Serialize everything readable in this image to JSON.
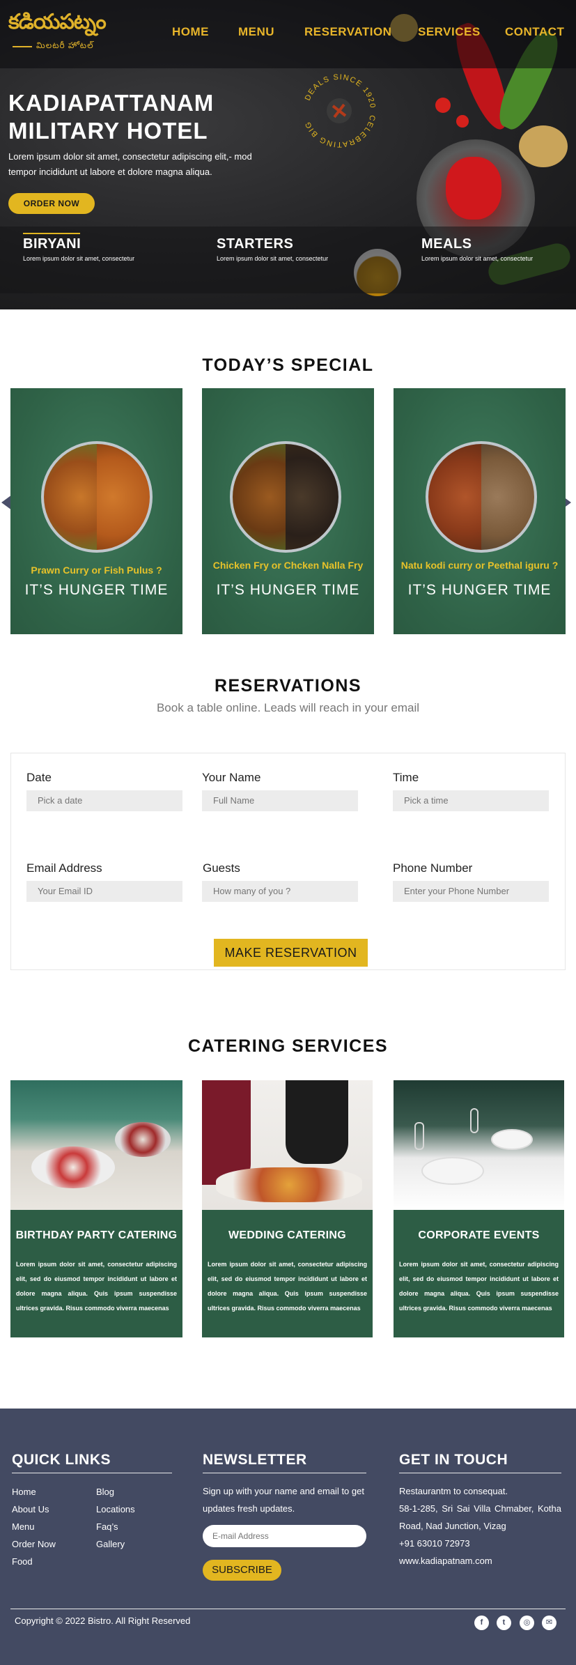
{
  "brand": {
    "logo_main": "కడియపట్నం",
    "logo_sub": "మిలటరీ హోటల్"
  },
  "nav": {
    "home": "HOME",
    "menu": "MENU",
    "reservation": "RESERVATION",
    "services": "SERVICES",
    "contact": "CONTACT"
  },
  "hero": {
    "title": "KADIAPATTANAM MILITARY HOTEL",
    "text": "Lorem ipsum dolor sit amet, consectetur adipiscing elit,- mod tempor incididunt ut labore et dolore magna aliqua.",
    "order_button": "ORDER NOW",
    "badge_top": "DEALS SINCE 1920",
    "badge_side": "CELEBRATING BIG",
    "categories": [
      {
        "title": "BIRYANI",
        "desc": "Lorem ipsum dolor sit amet, consectetur"
      },
      {
        "title": "STARTERS",
        "desc": "Lorem ipsum dolor sit amet, consectetur"
      },
      {
        "title": "MEALS",
        "desc": "Lorem ipsum dolor sit amet, consectetur"
      }
    ]
  },
  "special": {
    "title": "TODAY’S SPECIAL",
    "cards": [
      {
        "dish": "Prawn Curry or Fish Pulus ?",
        "caption": "IT’S HUNGER TIME"
      },
      {
        "dish": "Chicken Fry or Chcken Nalla Fry",
        "caption": "IT’S HUNGER TIME"
      },
      {
        "dish": "Natu kodi curry or Peethal iguru ?",
        "caption": "IT’S HUNGER TIME"
      }
    ]
  },
  "reservations": {
    "title": "RESERVATIONS",
    "subtitle": "Book a table online. Leads will reach in your email",
    "fields": {
      "date": {
        "label": "Date",
        "placeholder": "Pick a date"
      },
      "name": {
        "label": "Your Name",
        "placeholder": "Full Name"
      },
      "time": {
        "label": "Time",
        "placeholder": "Pick a time"
      },
      "email": {
        "label": "Email Address",
        "placeholder": "Your Email ID"
      },
      "guests": {
        "label": "Guests",
        "placeholder": "How many of you ?"
      },
      "phone": {
        "label": "Phone Number",
        "placeholder": "Enter your Phone Number"
      }
    },
    "button": "MAKE RESERVATION"
  },
  "catering": {
    "title": "CATERING SERVICES",
    "cards": [
      {
        "title": "BIRTHDAY PARTY CATERING",
        "desc": "Lorem ipsum dolor sit amet, consectetur adipiscing elit, sed do eiusmod tempor incididunt ut labore et dolore magna aliqua. Quis ipsum suspendisse ultrices gravida. Risus commodo viverra maecenas"
      },
      {
        "title": "WEDDING CATERING",
        "desc": "Lorem ipsum dolor sit amet, consectetur adipiscing elit, sed do eiusmod tempor incididunt ut labore et dolore magna aliqua. Quis ipsum suspendisse ultrices gravida. Risus commodo viverra maecenas"
      },
      {
        "title": "CORPORATE EVENTS",
        "desc": "Lorem ipsum dolor sit amet, consectetur adipiscing elit, sed do eiusmod tempor incididunt ut labore et dolore magna aliqua. Quis ipsum suspendisse ultrices gravida. Risus commodo viverra maecenas"
      }
    ]
  },
  "footer": {
    "quick_links_title": "QUICK LINKS",
    "links_col1": [
      "Home",
      "About Us",
      "Menu",
      "Order Now",
      "Food"
    ],
    "links_col2": [
      "Blog",
      "Locations",
      "Faq’s",
      "Gallery"
    ],
    "newsletter_title": "NEWSLETTER",
    "newsletter_text": "Sign up with your name and email to get updates fresh updates.",
    "newsletter_placeholder": "E-mail Address",
    "subscribe": "SUBSCRIBE",
    "contact_title": "GET IN TOUCH",
    "contact_line1": "Restaurantm to consequat.",
    "contact_address": "58-1-285, Sri Sai Villa Chmaber, Kotha Road, Nad Junction, Vizag",
    "contact_phone": "+91 63010 72973",
    "contact_web": "www.kadiapatnam.com",
    "copyright": "Copyright © 2022 Bistro. All Right Reserved",
    "social": [
      {
        "icon": "facebook-icon",
        "glyph": "f"
      },
      {
        "icon": "twitter-icon",
        "glyph": "t"
      },
      {
        "icon": "instagram-icon",
        "glyph": "◎"
      },
      {
        "icon": "mail-icon",
        "glyph": "✉"
      }
    ]
  },
  "colors": {
    "accent": "#e2b620",
    "green": "#2d5d45",
    "footer": "#434a62"
  }
}
